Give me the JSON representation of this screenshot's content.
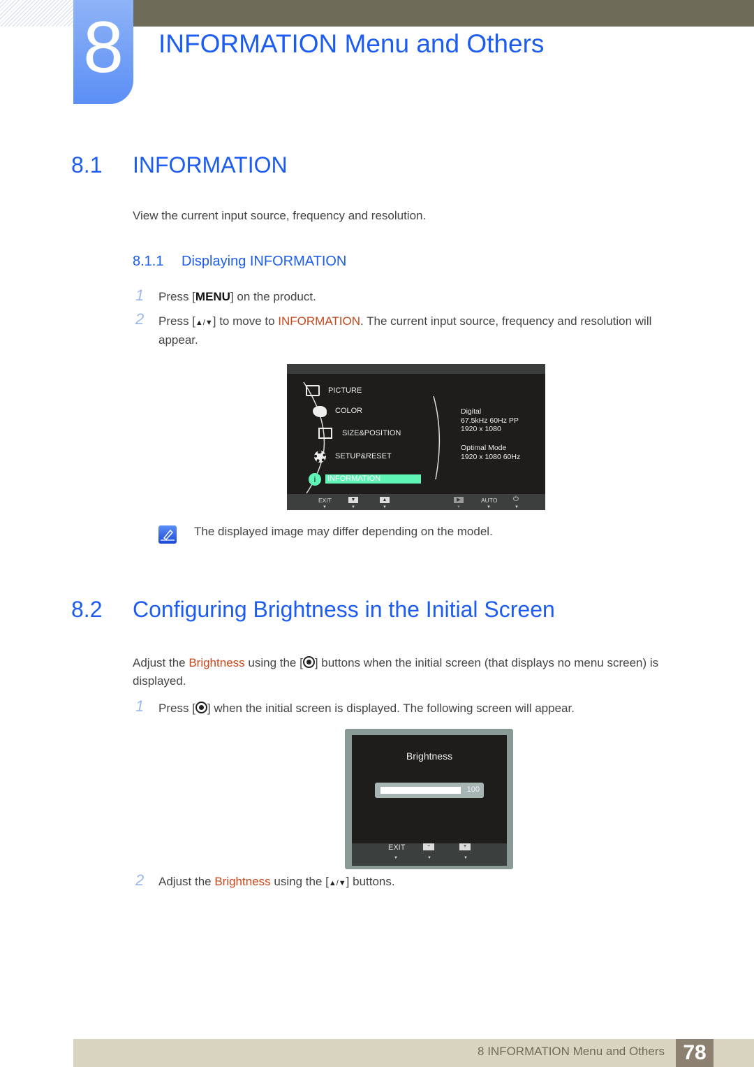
{
  "chapter": {
    "number": "8",
    "title": "INFORMATION Menu and Others"
  },
  "section_8_1": {
    "number": "8.1",
    "title": "INFORMATION",
    "intro": "View the current input source, frequency and resolution.",
    "subsection": {
      "number": "8.1.1",
      "title": "Displaying INFORMATION"
    },
    "steps": [
      {
        "num": "1",
        "pre": "Press [",
        "key": "MENU",
        "post": "] on the product."
      },
      {
        "num": "2",
        "pre": "Press [",
        "key": "▲/▼",
        "mid": "] to move to ",
        "hl": "INFORMATION",
        "post": ". The current input source, frequency and resolution will",
        "cont": "appear."
      }
    ],
    "osd": {
      "menu_items": [
        "PICTURE",
        "COLOR",
        "SIZE&POSITION",
        "SETUP&RESET",
        "INFORMATION"
      ],
      "selected_item": "INFORMATION",
      "info_lines": [
        "Digital",
        "67.5kHz 60Hz PP",
        "1920 x 1080",
        "",
        "Optimal Mode",
        "1920 x 1080 60Hz"
      ],
      "buttons": [
        "EXIT",
        "▼",
        "▲",
        "▶",
        "AUTO",
        "⏻"
      ]
    },
    "note": "The displayed image may differ depending on the model."
  },
  "section_8_2": {
    "number": "8.2",
    "title": "Configuring Brightness in the Initial Screen",
    "intro_pre": "Adjust the ",
    "intro_hl": "Brightness",
    "intro_mid": " using the [",
    "intro_post": "] buttons when the initial screen (that displays no menu screen) is",
    "intro_cont": "displayed.",
    "steps": [
      {
        "num": "1",
        "pre": "Press [",
        "post": "] when the initial screen is displayed. The following screen will appear."
      },
      {
        "num": "2",
        "pre": "Adjust the ",
        "hl": "Brightness",
        "mid": " using the [",
        "key": "▲/▼",
        "post": "] buttons."
      }
    ],
    "osd": {
      "title": "Brightness",
      "value": "100",
      "level_percent": 100,
      "buttons": [
        "EXIT",
        "−",
        "+"
      ]
    }
  },
  "footer": {
    "text": "8 INFORMATION Menu and Others",
    "page": "78"
  }
}
